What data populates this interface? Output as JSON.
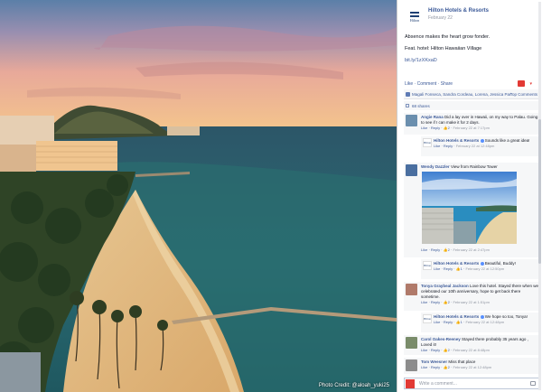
{
  "photo": {
    "credit": "Photo Credit: @aloah_yuki25"
  },
  "page": {
    "name": "Hilton Hotels & Resorts",
    "date": "February 22",
    "logo_text": "Hilton"
  },
  "post": {
    "line1": "Absence makes the heart grow fonder.",
    "line2": "Feat. hotel: Hilton Hawaiian Village",
    "link": "bit.ly/1zXKxaD"
  },
  "actions": "Like · Comment · Share",
  "likes": {
    "text": "Magali Fonseca, Sandra Cordeau, Lorena, Jessica Paris and 1,064 others like this.",
    "top_comments": "Top Comments"
  },
  "shares": "68 shares",
  "comments": [
    {
      "name": "Angie Rana",
      "text": "Did a lay over in Hawaii, on my way to Palau. Going to see if I can make it for 2 days.",
      "meta": "Like · Reply · ",
      "likes": "2",
      "time": "February 22 at 7:17pm",
      "reply": {
        "name": "Hilton Hotels & Resorts",
        "text": "Sounds like a great idea!",
        "meta": "Like · Reply · ",
        "time": "February 22 at 12:48pm"
      }
    },
    {
      "name": "Wendy Dazzler",
      "text": "View from Rainbow Tower",
      "meta": "Like · Reply · ",
      "likes": "2",
      "time": "February 22 at 2:47pm",
      "reply": {
        "name": "Hilton Hotels & Resorts",
        "text": "Beautiful, Buddy!",
        "meta": "Like · Reply · ",
        "likes": "1",
        "time": "February 22 at 12:50pm"
      }
    },
    {
      "name": "Tonya Graybeal Jackson",
      "text": "Love this hotel. Stayed there when we celebrated our 10th anniversary, hope to get back there sometime.",
      "meta": "Like · Reply · ",
      "likes": "2",
      "time": "February 22 at 1:51pm",
      "reply": {
        "name": "Hilton Hotels & Resorts",
        "text": "We hope so too, Tonya!",
        "meta": "Like · Reply · ",
        "likes": "1",
        "time": "February 22 at 12:48pm"
      }
    },
    {
      "name": "Carol Oakes-Reeney",
      "text": "Stayed there probably 35 years ago , Loved it!",
      "meta": "Like · Reply · ",
      "likes": "2",
      "time": "February 22 at 8:48pm"
    },
    {
      "name": "Tom Weesner",
      "text": "Miss that place",
      "meta": "Like · Reply · ",
      "likes": "2",
      "time": "February 22 at 12:48pm"
    }
  ],
  "composer": {
    "placeholder": "Write a comment..."
  },
  "colors": {
    "link": "#3b5998",
    "accent": "#e23a35"
  }
}
